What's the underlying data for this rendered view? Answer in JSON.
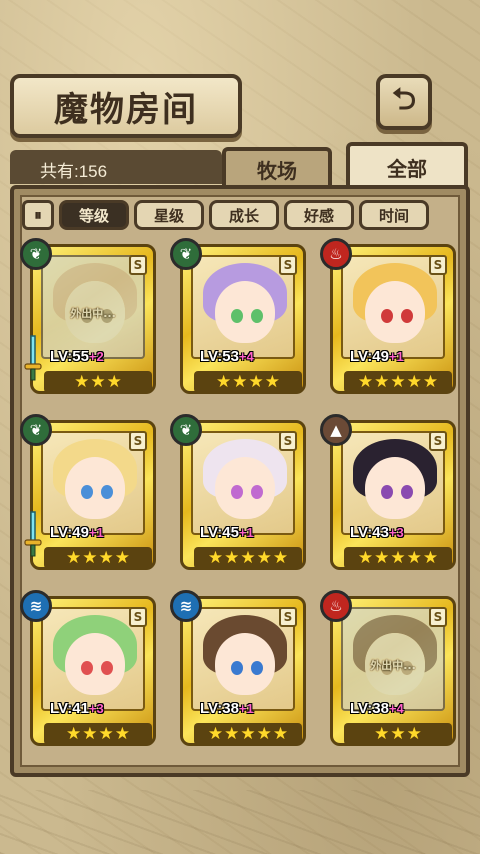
{
  "header": {
    "title": "魔物房间",
    "back_icon": "back-arrow-icon"
  },
  "summary": {
    "count_text": "共有:156"
  },
  "tabs": [
    {
      "label": "牧场",
      "active": false
    },
    {
      "label": "全部",
      "active": true
    }
  ],
  "sort": {
    "toggle_icon": "pause-sort-icon",
    "options": [
      {
        "label": "等级",
        "active": true
      },
      {
        "label": "星级",
        "active": false
      },
      {
        "label": "成长",
        "active": false
      },
      {
        "label": "好感",
        "active": false
      },
      {
        "label": "时间",
        "active": false
      }
    ]
  },
  "colors": {
    "leaf": "#2f6d3a",
    "fire": "#c0261f",
    "earth": "#6b4a36",
    "water": "#1e6fb3",
    "plus": "#ff5fc8",
    "star": "#ffd92b"
  },
  "monsters": [
    {
      "element": "leaf",
      "rank": "S",
      "level": "LV:55",
      "plus": "+2",
      "stars": 3,
      "away": true,
      "away_label": "外出中...",
      "weapon": true,
      "hair": "#e0b870",
      "eye": "#6bb06b"
    },
    {
      "element": "leaf",
      "rank": "S",
      "level": "LV:53",
      "plus": "+4",
      "stars": 4,
      "away": false,
      "weapon": false,
      "hair": "#b79be0",
      "eye": "#5ec06a"
    },
    {
      "element": "fire",
      "rank": "S",
      "level": "LV:49",
      "plus": "+1",
      "stars": 5,
      "away": false,
      "weapon": false,
      "hair": "#f2c45a",
      "eye": "#d03a3a"
    },
    {
      "element": "leaf",
      "rank": "S",
      "level": "LV:49",
      "plus": "+1",
      "stars": 4,
      "away": false,
      "weapon": true,
      "hair": "#f3d98a",
      "eye": "#4a8fd8"
    },
    {
      "element": "leaf",
      "rank": "S",
      "level": "LV:45",
      "plus": "+1",
      "stars": 5,
      "away": false,
      "weapon": false,
      "hair": "#eee4ef",
      "eye": "#c06ad0"
    },
    {
      "element": "earth",
      "rank": "S",
      "level": "LV:43",
      "plus": "+3",
      "stars": 5,
      "away": false,
      "weapon": false,
      "hair": "#2a2230",
      "eye": "#8a4ab0"
    },
    {
      "element": "water",
      "rank": "S",
      "level": "LV:41",
      "plus": "+3",
      "stars": 4,
      "away": false,
      "weapon": false,
      "hair": "#8fd17a",
      "eye": "#e05050"
    },
    {
      "element": "water",
      "rank": "S",
      "level": "LV:38",
      "plus": "+1",
      "stars": 5,
      "away": false,
      "weapon": false,
      "hair": "#6a4a30",
      "eye": "#3a7ad0"
    },
    {
      "element": "fire",
      "rank": "S",
      "level": "LV:38",
      "plus": "+4",
      "stars": 3,
      "away": true,
      "away_label": "外出中...",
      "weapon": false,
      "hair": "#c0603a",
      "eye": "#d09a4a"
    }
  ]
}
